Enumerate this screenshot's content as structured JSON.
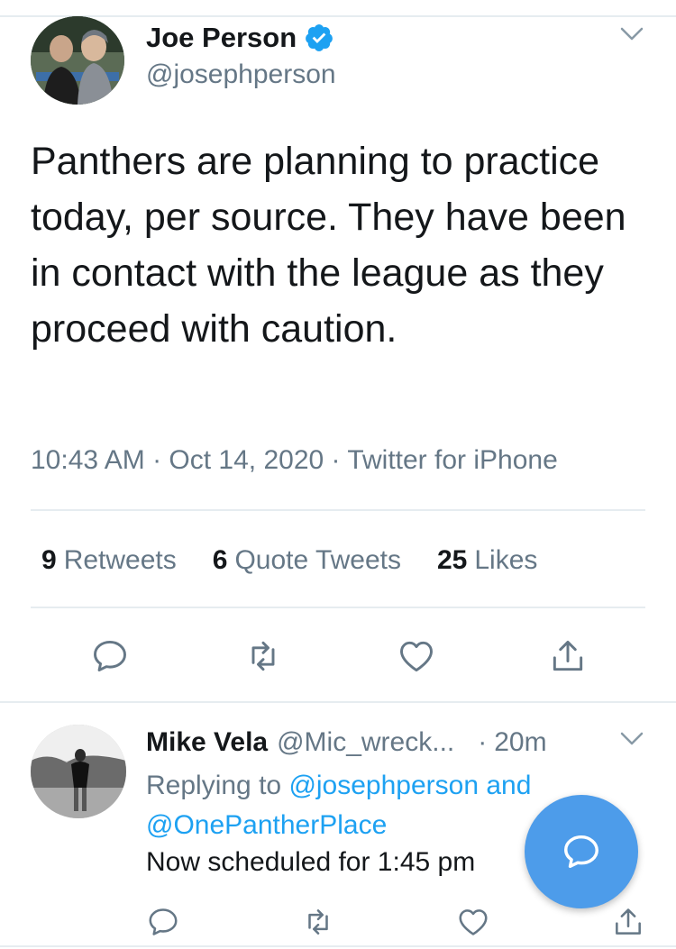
{
  "tweet": {
    "author_name": "Joe Person",
    "author_handle": "@josephperson",
    "text": "Panthers are planning to practice today, per source. They have been in contact with the league as they proceed with caution.",
    "meta": "10:43 AM · Oct 14, 2020 · Twitter for iPhone",
    "stats": {
      "retweets_count": "9",
      "retweets_label": "Retweets",
      "quotes_count": "6",
      "quotes_label": "Quote Tweets",
      "likes_count": "25",
      "likes_label": "Likes"
    },
    "icons": [
      "reply-icon",
      "retweet-icon",
      "like-icon",
      "share-icon"
    ]
  },
  "reply": {
    "author_name": "Mike Vela",
    "author_handle": "@Mic_wreck...",
    "time": "20m",
    "replying_prefix": "Replying to",
    "replying_user1": "@josephperson",
    "replying_and": "and",
    "replying_user2": "@OnePantherPlace",
    "text": "Now scheduled for 1:45 pm"
  },
  "colors": {
    "accent": "#1da1f2",
    "fab": "#4d9cea",
    "secondary_text": "#657786",
    "divider": "#e6ecf0"
  }
}
